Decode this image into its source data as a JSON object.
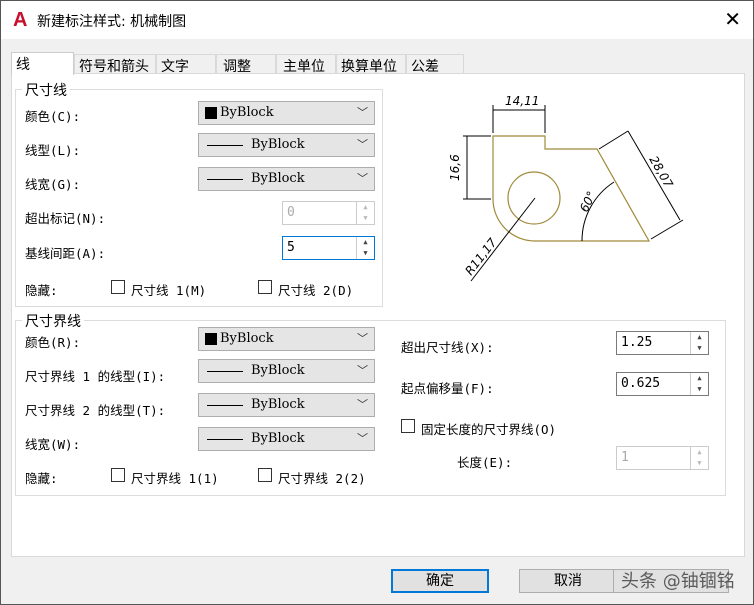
{
  "window": {
    "title": "新建标注样式: 机械制图",
    "logo": "A"
  },
  "tabs": [
    "线",
    "符号和箭头",
    "文字",
    "调整",
    "主单位",
    "换算单位",
    "公差"
  ],
  "dim_lines": {
    "group": "尺寸线",
    "color_label": "颜色(C):",
    "color_value": "ByBlock",
    "linetype_label": "线型(L):",
    "linetype_value": "ByBlock",
    "lineweight_label": "线宽(G):",
    "lineweight_value": "ByBlock",
    "extend_ticks_label": "超出标记(N):",
    "extend_ticks_value": "0",
    "baseline_label": "基线间距(A):",
    "baseline_value": "5",
    "suppress_label": "隐藏:",
    "suppress1": "尺寸线 1(M)",
    "suppress2": "尺寸线 2(D)"
  },
  "ext_lines": {
    "group": "尺寸界线",
    "color_label": "颜色(R):",
    "color_value": "ByBlock",
    "lt1_label": "尺寸界线 1 的线型(I):",
    "lt1_value": "ByBlock",
    "lt2_label": "尺寸界线 2 的线型(T):",
    "lt2_value": "ByBlock",
    "lw_label": "线宽(W):",
    "lw_value": "ByBlock",
    "suppress_label": "隐藏:",
    "suppress1": "尺寸界线 1(1)",
    "suppress2": "尺寸界线 2(2)",
    "extend_label": "超出尺寸线(X):",
    "extend_value": "1.25",
    "offset_label": "起点偏移量(F):",
    "offset_value": "0.625",
    "fixed_label": "固定长度的尺寸界线(O)",
    "length_label": "长度(E):",
    "length_value": "1"
  },
  "preview": {
    "dim_top": "14,11",
    "dim_left": "16,6",
    "dim_right": "28,07",
    "angle": "60°",
    "radius": "R11,17"
  },
  "buttons": {
    "ok": "确定",
    "cancel": "取消"
  },
  "watermark": "头条 @铀锢铭"
}
